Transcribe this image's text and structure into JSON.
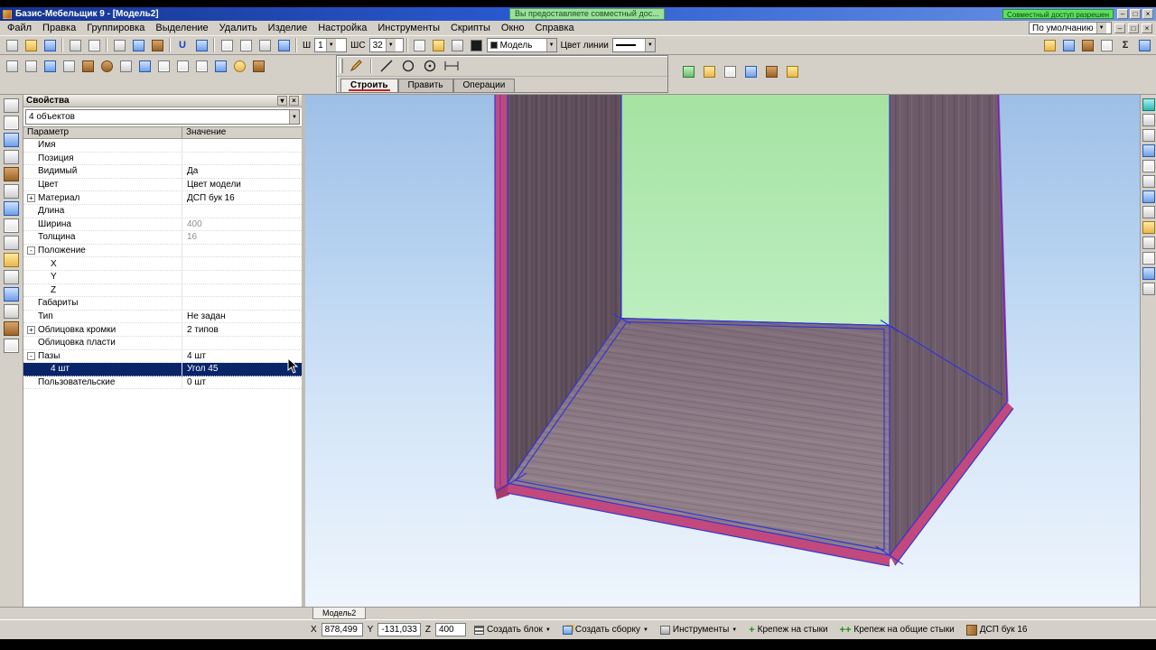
{
  "title_bar": {
    "app_title": "Базис-Мебельщик 9 - [Модель2]",
    "notification": "Вы предоставляете совместный дос...",
    "share_badge": "Совместный доступ разрешен",
    "window_buttons": {
      "minimize": "–",
      "maximize": "□",
      "close": "×"
    }
  },
  "menu_bar": {
    "items": [
      "Файл",
      "Правка",
      "Группировка",
      "Выделение",
      "Удалить",
      "Изделие",
      "Настройка",
      "Инструменты",
      "Скрипты",
      "Окно",
      "Справка"
    ],
    "profile_combo": "По умолчанию",
    "mdi_buttons": {
      "minimize": "–",
      "restore": "□",
      "close": "×"
    }
  },
  "toolbar": {
    "width_label": "Ш",
    "width_value": "1",
    "ws_label": "ШС",
    "ws_value": "32",
    "model_combo": "Модель",
    "line_color_label": "Цвет линии"
  },
  "draw_panel": {
    "tabs": [
      "Строить",
      "Править",
      "Операции"
    ],
    "active_tab": "Строить"
  },
  "properties_panel": {
    "title": "Свойства",
    "object_selector": "4 объектов",
    "columns": [
      "Параметр",
      "Значение"
    ],
    "rows": [
      {
        "param": "Имя",
        "value": "",
        "expand": "",
        "indent": 0
      },
      {
        "param": "Позиция",
        "value": "",
        "expand": "",
        "indent": 0
      },
      {
        "param": "Видимый",
        "value": "Да",
        "expand": "",
        "indent": 0
      },
      {
        "param": "Цвет",
        "value": "Цвет модели",
        "expand": "",
        "indent": 0
      },
      {
        "param": "Материал",
        "value": "ДСП бук 16",
        "expand": "+",
        "indent": 0
      },
      {
        "param": "Длина",
        "value": "",
        "expand": "",
        "indent": 0
      },
      {
        "param": "Ширина",
        "value": "400",
        "expand": "",
        "indent": 0,
        "muted": true
      },
      {
        "param": "Толщина",
        "value": "16",
        "expand": "",
        "indent": 0,
        "muted": true
      },
      {
        "param": "Положение",
        "value": "",
        "expand": "-",
        "indent": 0
      },
      {
        "param": "X",
        "value": "",
        "expand": "",
        "indent": 1
      },
      {
        "param": "Y",
        "value": "",
        "expand": "",
        "indent": 1
      },
      {
        "param": "Z",
        "value": "",
        "expand": "",
        "indent": 1
      },
      {
        "param": "Габариты",
        "value": "",
        "expand": "",
        "indent": 0
      },
      {
        "param": "Тип",
        "value": "Не задан",
        "expand": "",
        "indent": 0
      },
      {
        "param": "Облицовка кромки",
        "value": "2 типов",
        "expand": "+",
        "indent": 0
      },
      {
        "param": "Облицовка пласти",
        "value": "",
        "expand": "",
        "indent": 0
      },
      {
        "param": "Пазы",
        "value": "4 шт",
        "expand": "-",
        "indent": 0
      },
      {
        "param": "4 шт",
        "value": "Угол 45",
        "expand": "",
        "indent": 1,
        "selected": true
      },
      {
        "param": "Пользовательские",
        "value": "0 шт",
        "expand": "",
        "indent": 0
      }
    ]
  },
  "viewport": {
    "model_tab": "Модель2"
  },
  "status_bar": {
    "coords": {
      "x_label": "X",
      "x_value": "878,499",
      "y_label": "Y",
      "y_value": "-131,033",
      "z_label": "Z",
      "z_value": "400"
    },
    "buttons": [
      {
        "label": "Создать блок",
        "arrow": "▼"
      },
      {
        "label": "Создать сборку",
        "arrow": "▼"
      },
      {
        "label": "Инструменты",
        "arrow": "▼"
      },
      {
        "label": "Крепеж на стыки",
        "arrow": ""
      },
      {
        "label": "Крепеж на общие стыки",
        "arrow": ""
      }
    ],
    "material": "ДСП бук 16"
  },
  "colors": {
    "titlebar_blue": "#2a5ad0",
    "selection_navy": "#0a246a",
    "share_green": "#5ce05c",
    "viewport_gradient_top": "#9ebfe6",
    "viewport_gradient_bottom": "#eef5fd",
    "back_panel_green": "#abe6ab",
    "side_wood": "#6c5b66",
    "floor_wood": "#918089",
    "edge_pink": "#c2497c",
    "outline_blue": "#3434d6"
  }
}
